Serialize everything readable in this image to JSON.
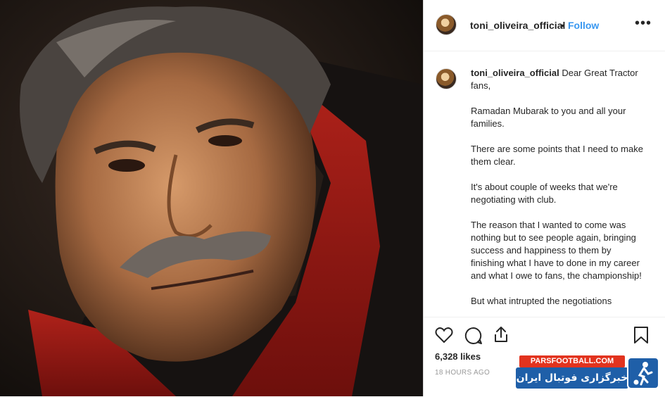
{
  "post": {
    "username": "toni_oliveira_official",
    "separator": "•",
    "follow_label": "Follow",
    "more_label": "•••",
    "caption_user": "toni_oliveira_official",
    "caption_paragraphs": [
      "Dear Great Tractor fans,",
      "Ramadan Mubarak to you and all your families.",
      "There are some points that I need to make them clear.",
      "It's about couple of weeks that we're negotiating with club.",
      "The reason that I wanted to come was nothing but to see people again, bringing success and happiness to them by finishing what I have to done in my career and what I owe to fans, the championship!",
      "But what intrupted the negotiations"
    ],
    "likes": "6,328 likes",
    "time": "18 HOURS AGO"
  },
  "icons": {
    "like": "heart-icon",
    "comment": "comment-icon",
    "share": "share-icon",
    "save": "bookmark-icon"
  },
  "watermark": {
    "site": "PARSFOOTBALL.COM",
    "tagline": "خبرگزاری فوتبال ایران"
  },
  "colors": {
    "follow": "#3897f0",
    "muted": "#999999",
    "watermark_red": "#e2331e",
    "watermark_blue": "#1f5fa8"
  }
}
